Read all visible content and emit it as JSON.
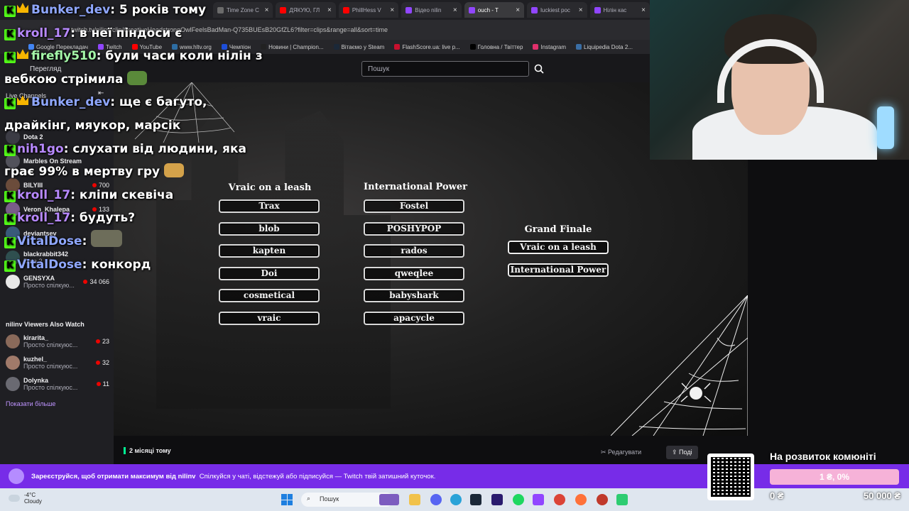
{
  "browser": {
    "tabs": [
      {
        "label": "Time Zone C",
        "color": "#6b6b6b"
      },
      {
        "label": "ДЯКУЮ, ГЛ",
        "color": "#ff0000"
      },
      {
        "label": "PhillHess V",
        "color": "#ff0000"
      },
      {
        "label": "Відео nilin",
        "color": "#9146ff"
      },
      {
        "label": "ouch - T",
        "color": "#9146ff"
      },
      {
        "label": "luckiest poc",
        "color": "#9146ff"
      },
      {
        "label": "Нілін кас",
        "color": "#9146ff"
      }
    ],
    "url": "twitch.tv/nilinv/clip/CreativeHeadstrongOwlFeelsBadMan-Q735BUEsB20GfZL6?filter=clips&range=all&sort=time",
    "bookmarks": [
      {
        "label": "Google Перекладач",
        "color": "#4285f4"
      },
      {
        "label": "Twitch",
        "color": "#9146ff"
      },
      {
        "label": "YouTube",
        "color": "#ff0000"
      },
      {
        "label": "www.hltv.org",
        "color": "#2d6da3"
      },
      {
        "label": "Чемпіон",
        "color": "#1d4ed8"
      },
      {
        "label": "Новини | Champion...",
        "color": "#222222"
      },
      {
        "label": "Вітаємо у Steam",
        "color": "#1b2838"
      },
      {
        "label": "FlashScore.ua: live р...",
        "color": "#c8102e"
      },
      {
        "label": "Головна / Твіттер",
        "color": "#000000"
      },
      {
        "label": "Instagram",
        "color": "#e1306c"
      },
      {
        "label": "Liquipedia Dota 2...",
        "color": "#3a6ea5"
      }
    ]
  },
  "sidebar": {
    "collapse_label": "Перегляд",
    "live_channels": "Live Channels",
    "channels": [
      {
        "name": "Dota 2",
        "game": "",
        "viewers": ""
      },
      {
        "name": "Marbles On Stream",
        "game": "",
        "viewers": ""
      },
      {
        "name": "BILYIII",
        "game": "",
        "viewers": "700"
      },
      {
        "name": "Veron_Khalepa",
        "game": "",
        "viewers": "133"
      },
      {
        "name": "deviantsev",
        "game": "",
        "viewers": "169"
      },
      {
        "name": "blackrabbit342",
        "game": "Dota 2",
        "viewers": ""
      },
      {
        "name": "GENSYXA",
        "game": "Просто спілкую...",
        "viewers": "34 066"
      }
    ],
    "also_watch": "nilinv Viewers Also Watch",
    "also_channels": [
      {
        "name": "kirarita_",
        "game": "Просто спілкуюс...",
        "viewers": "23"
      },
      {
        "name": "kuzhel_",
        "game": "Просто спілкуюс...",
        "viewers": "32"
      },
      {
        "name": "Dolynka",
        "game": "Просто спілкуюс...",
        "viewers": "11"
      }
    ],
    "show_more": "Показати більше"
  },
  "search": {
    "placeholder": "Пошук"
  },
  "bracket": {
    "team1": {
      "title": "Vraic on a leash",
      "players": [
        "Trax",
        "blob",
        "kapten",
        "Doi",
        "cosmetical",
        "vraic"
      ]
    },
    "team2": {
      "title": "International Power",
      "players": [
        "Fostel",
        "POSHYPOP",
        "rados",
        "qweqlee",
        "babyshark",
        "apacycle"
      ]
    },
    "final": {
      "title": "Grand Finale",
      "teams": [
        "Vraic on a leash",
        "International Power"
      ]
    }
  },
  "info": {
    "time_ago": "2 місяці тому",
    "edit": "Редагувати",
    "share": "Поді"
  },
  "banner": {
    "bold": "Зареєструйся, щоб отримати максимум від nilinv",
    "text": "Спілкуйся у чаті, відстежуй або підписуйся — Twitch твій затишний куточок."
  },
  "taskbar": {
    "temp": "-4°C",
    "weather": "Cloudy",
    "search": "Пошук"
  },
  "chat": [
    {
      "user": "Bunker_dev",
      "text": ": 5 років тому",
      "color": "blue",
      "crown": true
    },
    {
      "user": "kroll_17",
      "text": ": в неї піндоси є",
      "color": "purple",
      "crown": false
    },
    {
      "user": "firefly510",
      "text": ": були часи коли нілін з",
      "color": "green",
      "crown": true
    },
    {
      "user": "",
      "text": "вебкою стрімила",
      "color": "",
      "crown": false
    },
    {
      "user": "Bunker_dev",
      "text": ": ще є багуто,",
      "color": "blue",
      "crown": true
    },
    {
      "user": "",
      "text": "драйкінг, мяукор, марсік",
      "color": "",
      "crown": false
    },
    {
      "user": "nih1go",
      "text": ": слухати від людини, яка",
      "color": "purple",
      "crown": false
    },
    {
      "user": "",
      "text": "грає 99% в мертву гру",
      "color": "",
      "crown": false
    },
    {
      "user": "kroll_17",
      "text": ": кліпи скевіча",
      "color": "purple",
      "crown": false
    },
    {
      "user": "kroll_17",
      "text": ": будуть?",
      "color": "purple",
      "crown": false
    },
    {
      "user": "VitalDose",
      "text": ":",
      "color": "blue",
      "crown": false
    },
    {
      "user": "VitalDose",
      "text": ": конкорд",
      "color": "blue",
      "crown": false
    }
  ],
  "donation": {
    "title": "На розвиток комюніті",
    "progress_text": "1 ₴, 0%",
    "progress_fraction": 0.0,
    "min": "0 ₴",
    "max": "50 000 ₴"
  }
}
